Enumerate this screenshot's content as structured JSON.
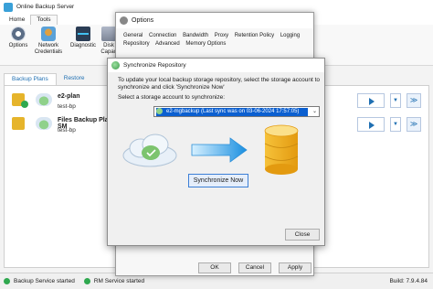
{
  "app": {
    "title": "Online Backup Server",
    "tabs": [
      "Home",
      "Tools"
    ],
    "ribbon": [
      {
        "label": "Options",
        "icon": "gear-icon"
      },
      {
        "label": "Network Credentials",
        "icon": "network-icon"
      },
      {
        "label": "Diagnostic",
        "icon": "diagnostic-icon"
      },
      {
        "label": "Disk Capac",
        "icon": "disk-icon"
      }
    ],
    "side_tabs": [
      "Backup Plans",
      "Restore"
    ],
    "plans": [
      {
        "name": "e2-plan",
        "storage": "test-bp"
      },
      {
        "name": "Files Backup Plan SM",
        "storage": "test-bp"
      }
    ],
    "status": {
      "backup_service": "Backup Service started",
      "rm_service": "RM Service started",
      "build": "Build: 7.9.4.84"
    }
  },
  "options": {
    "title": "Options",
    "tabs": [
      "General",
      "Connection",
      "Bandwidth",
      "Proxy",
      "Retention Policy",
      "Logging",
      "Repository",
      "Advanced",
      "Memory Options"
    ],
    "ok": "OK",
    "cancel": "Cancel",
    "apply": "Apply"
  },
  "sync": {
    "title": "Synchronize Repository",
    "description": "To update your local backup storage repository, select the storage account to synchronize and click 'Synchronize Now'",
    "select_label": "Select a storage account to synchronize:",
    "selected_account": "e2-mgbackup (Last sync was on 03-06-2024 17:57:05)",
    "sync_now": "Synchronize Now",
    "close": "Close"
  }
}
